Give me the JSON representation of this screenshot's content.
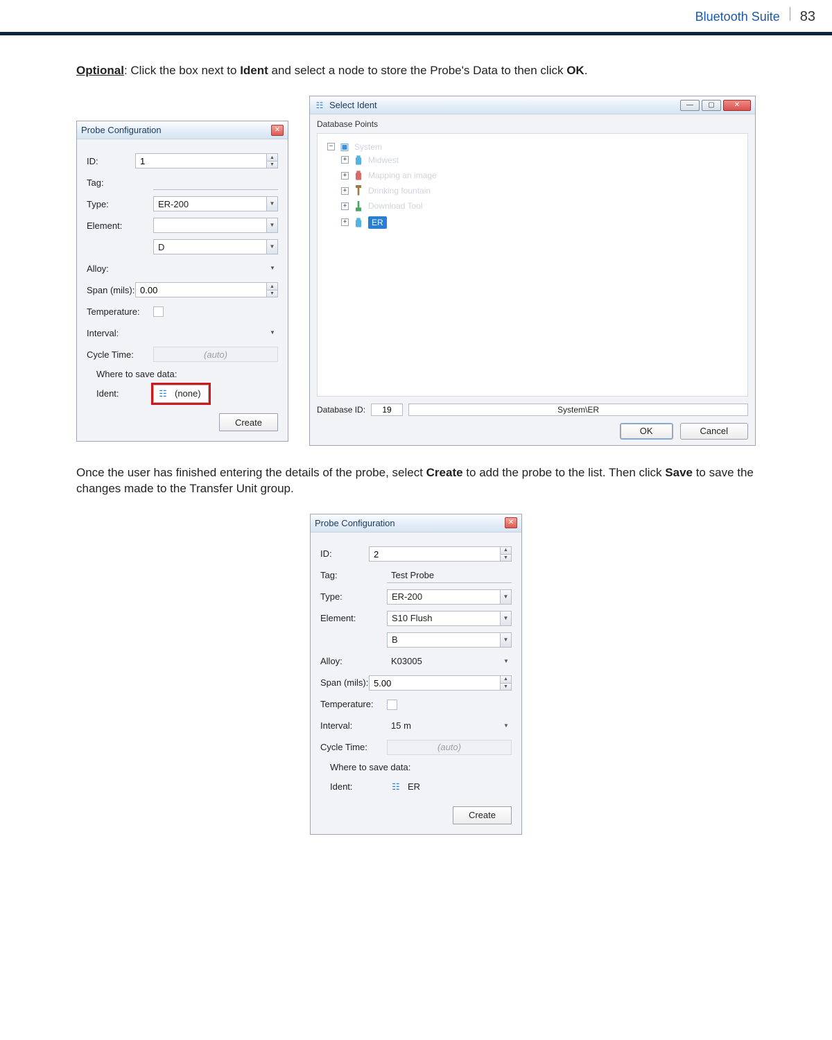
{
  "header": {
    "section": "Bluetooth Suite",
    "page_number": "83"
  },
  "text": {
    "optional_label": "Optional",
    "optional_rest": ": Click the box next to ",
    "ident_word": "Ident",
    "optional_tail": " and select a node to store the Probe's Data to then click ",
    "ok_word": "OK",
    "period": ".",
    "para2a": "Once the user has finished entering the details of the probe, select ",
    "create_word": "Create",
    "para2b": " to add the probe to the list. Then click ",
    "save_word": "Save",
    "para2c": " to save the changes made to the Transfer Unit group."
  },
  "probe_dialog": {
    "title": "Probe Configuration",
    "labels": {
      "id": "ID:",
      "tag": "Tag:",
      "type": "Type:",
      "element": "Element:",
      "alloy": "Alloy:",
      "span": "Span (mils):",
      "temperature": "Temperature:",
      "interval": "Interval:",
      "cycle": "Cycle Time:",
      "save_section": "Where to save data:",
      "ident": "Ident:"
    },
    "cycle_auto": "(auto)",
    "create_btn": "Create",
    "instance_a": {
      "id": "1",
      "tag": "",
      "type": "ER-200",
      "element": "",
      "sub": "D",
      "alloy": "",
      "span": "0.00",
      "interval": "",
      "ident": "(none)"
    },
    "instance_b": {
      "id": "2",
      "tag": "Test Probe",
      "type": "ER-200",
      "element": "S10 Flush",
      "sub": "B",
      "alloy": "K03005",
      "span": "5.00",
      "interval": "15 m",
      "ident": "ER"
    }
  },
  "ident_dialog": {
    "title": "Select Ident",
    "database_points": "Database Points",
    "root": "System",
    "children": [
      {
        "label": "Midwest"
      },
      {
        "label": "Mapping an image"
      },
      {
        "label": "Drinking fountain"
      },
      {
        "label": "Download Tool"
      },
      {
        "label": "ER",
        "selected": true
      }
    ],
    "db_id_label": "Database ID:",
    "db_id_value": "19",
    "db_path": "System\\ER",
    "ok": "OK",
    "cancel": "Cancel"
  }
}
